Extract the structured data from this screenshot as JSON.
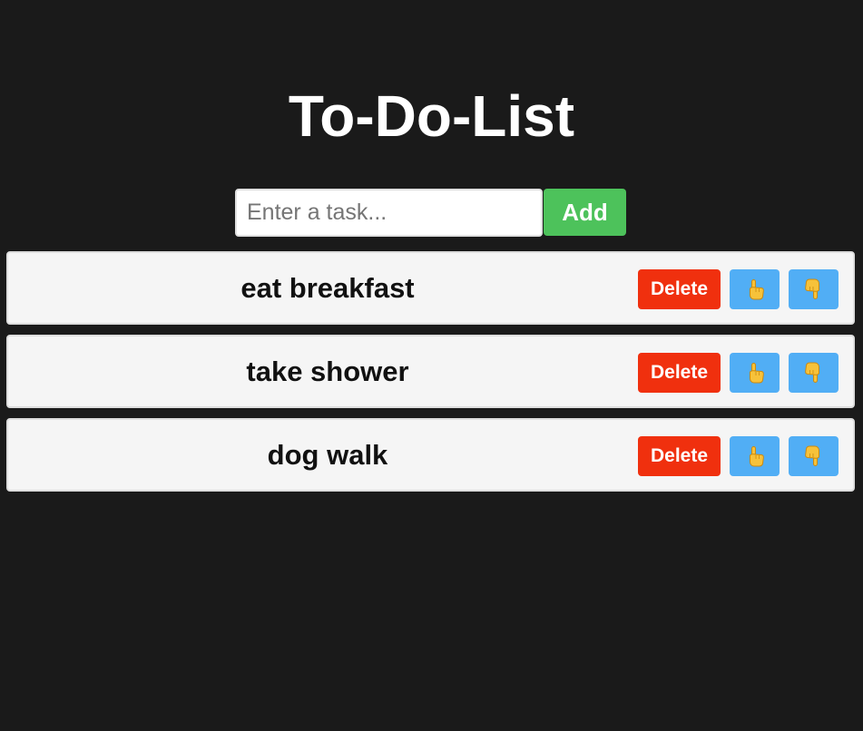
{
  "app": {
    "title": "To-Do-List"
  },
  "new_task": {
    "placeholder": "Enter a task...",
    "value": "",
    "add_label": "Add"
  },
  "tasks": [
    {
      "text": "eat breakfast",
      "delete_label": "Delete",
      "up_icon": "pointing-up-hand-icon",
      "down_icon": "pointing-down-hand-icon"
    },
    {
      "text": "take shower",
      "delete_label": "Delete",
      "up_icon": "pointing-up-hand-icon",
      "down_icon": "pointing-down-hand-icon"
    },
    {
      "text": "dog walk",
      "delete_label": "Delete",
      "up_icon": "pointing-up-hand-icon",
      "down_icon": "pointing-down-hand-icon"
    }
  ],
  "colors": {
    "background": "#1a1a1a",
    "add_button": "#4dc25b",
    "delete_button": "#f0300e",
    "move_button": "#51aef5",
    "hand": "#f7c23a",
    "task_background": "#f5f5f5"
  }
}
